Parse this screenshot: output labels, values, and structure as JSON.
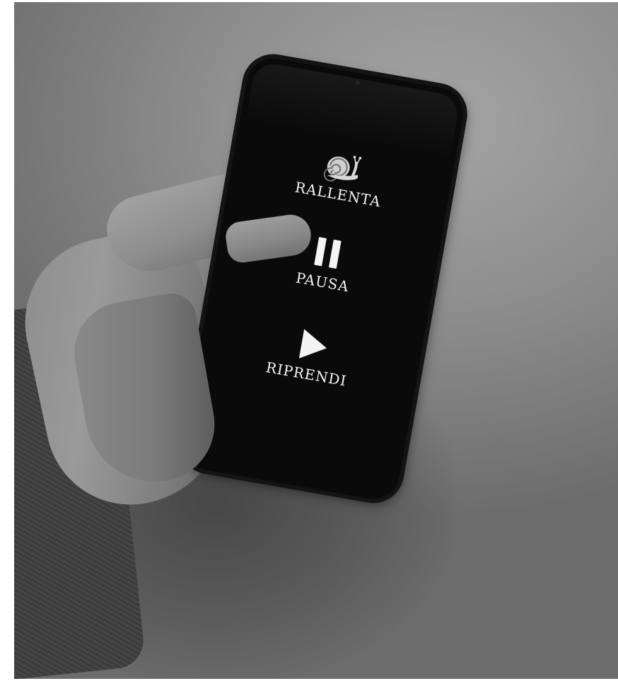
{
  "screen": {
    "controls": [
      {
        "label": "RALLENTA",
        "icon": "snail-icon"
      },
      {
        "label": "PAUSA",
        "icon": "pause-icon"
      },
      {
        "label": "RIPRENDI",
        "icon": "play-icon"
      }
    ]
  },
  "colors": {
    "screen_background": "#0a0a0a",
    "label_color": "#f4f4f4",
    "wall": "#9a9a9a"
  }
}
